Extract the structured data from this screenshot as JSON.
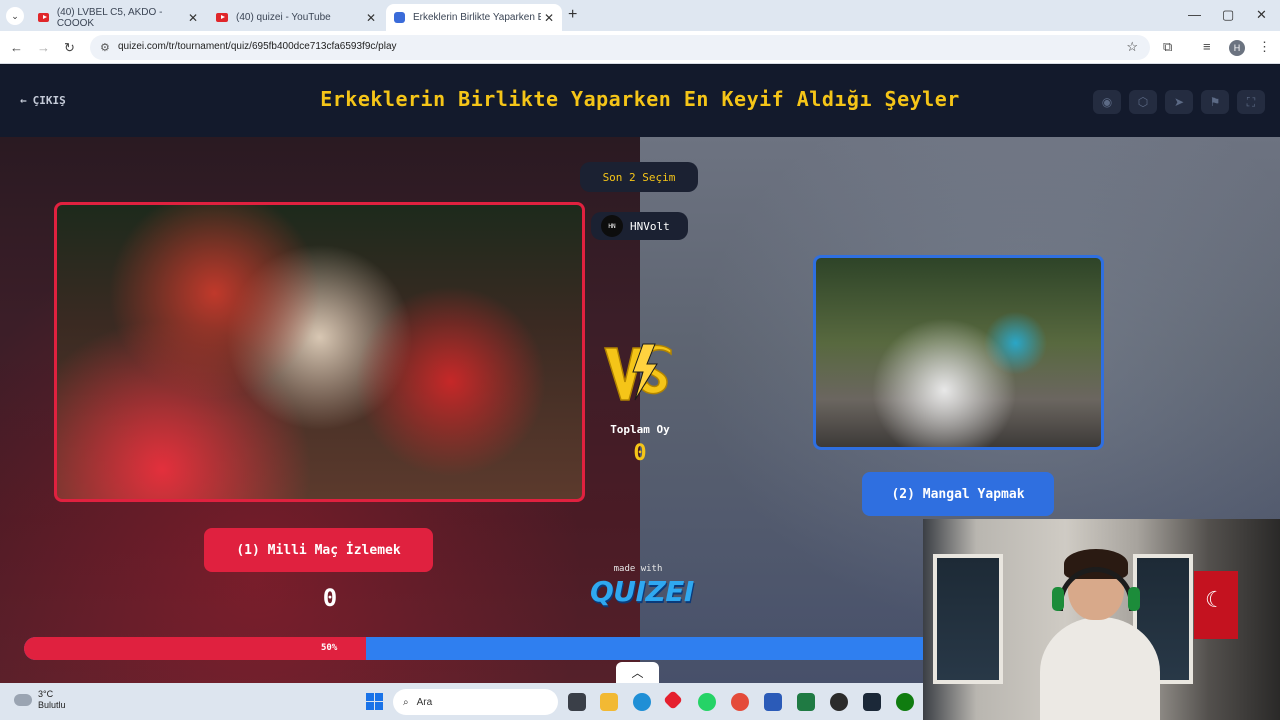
{
  "browser": {
    "tabs": [
      {
        "label": "(40) LVBEL C5, AKDO - COOOK",
        "close": "✕"
      },
      {
        "label": "(40) quizei - YouTube",
        "close": "✕"
      },
      {
        "label": "Erkeklerin Birlikte Yaparken En K",
        "close": "✕"
      }
    ],
    "new_tab": "+",
    "url": "quizei.com/tr/tournament/quiz/695fb400dce713cfa6593f9c/play",
    "profile_initial": "H",
    "window_controls": [
      "—",
      "▢",
      "✕"
    ]
  },
  "header": {
    "exit_label": "ÇIKIŞ",
    "title": "Erkeklerin Birlikte Yaparken En Keyif Aldığı Şeyler",
    "icons": [
      "eye-icon",
      "share-icon",
      "send-icon",
      "flag-icon",
      "fullscreen-icon"
    ]
  },
  "match": {
    "round_label": "Son 2 Seçim",
    "creator": "HNVolt",
    "creator_avatar_text": "HN",
    "vs_text": "VS",
    "total_votes_label": "Toplam Oy",
    "total_votes_value": "0",
    "left": {
      "label": "(1) Milli Maç İzlemek",
      "votes": "0",
      "color": "#e0213f"
    },
    "right": {
      "label": "(2) Mangal Yapmak",
      "color": "#2f6fe0"
    },
    "progress": {
      "left_percent": 50,
      "label": "50%"
    },
    "made_with": "made with",
    "brand": "QUIZEI"
  },
  "taskbar": {
    "weather_temp": "3°C",
    "weather_desc": "Bulutlu",
    "search_placeholder": "Ara"
  },
  "colors": {
    "accent": "#f5c518",
    "left": "#e0213f",
    "right": "#2f6fe0"
  }
}
